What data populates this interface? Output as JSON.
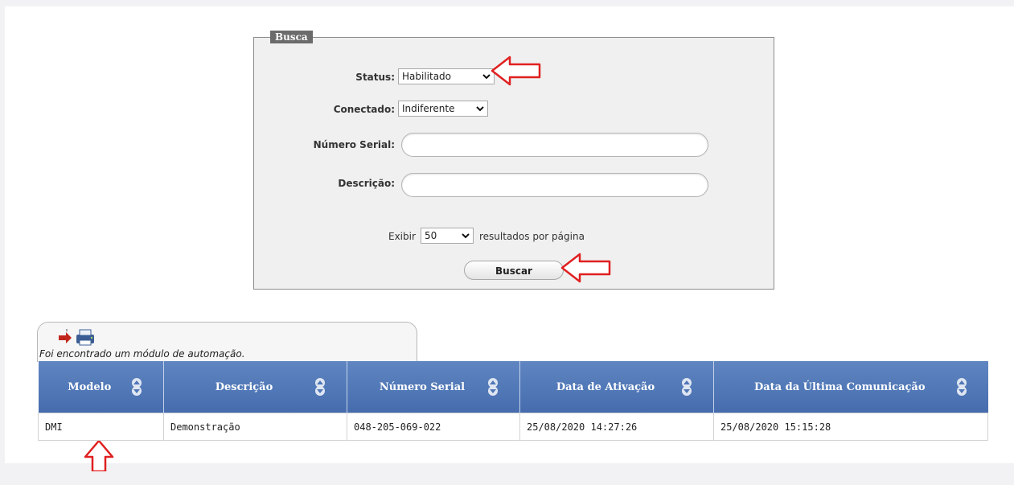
{
  "busca": {
    "legend": "Busca",
    "status": {
      "label": "Status:",
      "value": "Habilitado"
    },
    "conectado": {
      "label": "Conectado:",
      "value": "Indiferente"
    },
    "numero_serial": {
      "label": "Número Serial:",
      "value": ""
    },
    "descricao": {
      "label": "Descrição:",
      "value": ""
    },
    "exibir": {
      "prefix": "Exibir",
      "value": "50",
      "suffix": "resultados por página"
    },
    "buscar_label": "Buscar"
  },
  "result": {
    "message": "Foi encontrado um módulo de automação.",
    "icon": "printer-arrow-icon"
  },
  "table": {
    "headers": [
      "Modelo",
      "Descrição",
      "Número Serial",
      "Data de Ativação",
      "Data da Última Comunicação"
    ],
    "rows": [
      [
        "DMI",
        "Demonstração",
        "048-205-069-022",
        "25/08/2020 14:27:26",
        "25/08/2020 15:15:28"
      ]
    ]
  },
  "colors": {
    "header_blue": "#4f76b6",
    "annotation_red": "#e02020",
    "legend_gray": "#6b6b6b"
  }
}
